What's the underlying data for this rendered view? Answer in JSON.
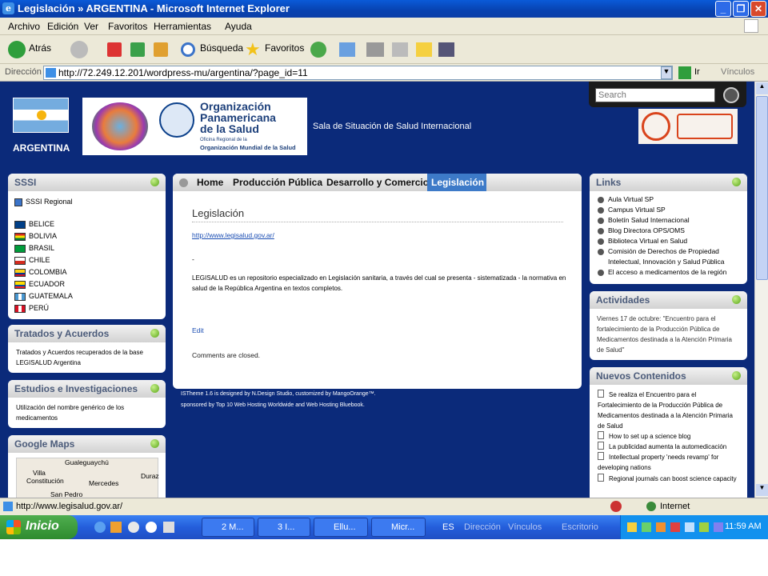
{
  "window": {
    "title": "Legislación » ARGENTINA - Microsoft Internet Explorer"
  },
  "menu": [
    "Archivo",
    "Edición",
    "Ver",
    "Favoritos",
    "Herramientas",
    "Ayuda"
  ],
  "toolbar": {
    "back": "Atrás",
    "search": "Búsqueda",
    "favorites": "Favoritos"
  },
  "address": {
    "label": "Dirección",
    "url": "http://72.249.12.201/wordpress-mu/argentina/?page_id=11",
    "go": "Ir",
    "links": "Vínculos"
  },
  "site": {
    "country": "ARGENTINA",
    "org_name_1": "Organización",
    "org_name_2": "Panamericana",
    "org_name_3": "de la Salud",
    "org_sub_1": "Oficina Regional de la",
    "org_sub_2": "Organización Mundial de la Salud",
    "tagline": "Sala de Situación de Salud Internacional",
    "search_placeholder": "Search"
  },
  "nav": [
    "Home",
    "Producción Pública",
    "Desarrollo y Comercio",
    "Legislación"
  ],
  "left": {
    "sssi": {
      "title": "SSSI",
      "regional": "SSSI Regional",
      "countries": [
        "BELICE",
        "BOLIVIA",
        "BRASIL",
        "CHILE",
        "COLOMBIA",
        "ECUADOR",
        "GUATEMALA",
        "PERÚ"
      ]
    },
    "tratados": {
      "title": "Tratados y Acuerdos",
      "text": "Tratados y Acuerdos recuperados de la base LEGISALUD Argentina"
    },
    "estudios": {
      "title": "Estudios e Investigaciones",
      "text": "Utilización del nombre genérico de los medicamentos"
    },
    "maps": {
      "title": "Google Maps",
      "labels": [
        "Gualeguaychú",
        "Villa",
        "Constitución",
        "Mercedes",
        "Duraz",
        "San Pedro"
      ]
    }
  },
  "main": {
    "title": "Legislación",
    "link": "http://www.legisalud.gov.ar/",
    "dash": "-",
    "body": "LEGISALUD es un repositorio especializado en  Legislación sanitaria,  a través del cual se presenta - sistematizada - la normativa en salud de la República Argentina en textos completos.",
    "edit": "Edit",
    "closed": "Comments are closed."
  },
  "footer": {
    "line1": "ISTheme 1.6 is designed by N.Design Studio, customized by MangoOrange™.",
    "line2": "sponsored by Top 10 Web Hosting Worldwide and Web Hosting Bluebook."
  },
  "right": {
    "links": {
      "title": "Links",
      "items": [
        "Aula Virtual SP",
        "Campus Virtual SP",
        "Boletín Salud Internacional",
        "Blog Directora OPS/OMS",
        "Biblioteca Virtual en Salud",
        "Comisión de Derechos de Propiedad",
        "Intelectual, Innovación y Salud Pública",
        "El acceso a medicamentos de la región"
      ]
    },
    "actividades": {
      "title": "Actividades",
      "text": "Viernes 17 de octubre: \"Encuentro para el fortalecimiento de la Producción Pública de Medicamentos destinada a la Atención Primaria de Salud\""
    },
    "nuevos": {
      "title": "Nuevos Contenidos",
      "items": [
        "Se realiza el Encuentro para el Fortalecimiento de la Producción Pública de Medicamentos destinada a la Atención Primaria de Salud",
        "How to set up a science blog",
        "La publicidad aumenta la automedicación",
        "Intellectual property 'needs revamp' for developing nations",
        "Regional journals can boost science capacity"
      ]
    }
  },
  "status": {
    "url": "http://www.legisalud.gov.ar/",
    "zone": "Internet"
  },
  "taskbar": {
    "start": "Inicio",
    "tasks": [
      "2 M...",
      "3 I...",
      "Ellu...",
      "Micr..."
    ],
    "lang": "ES",
    "tray_labels": [
      "Dirección",
      "Vínculos",
      "Escritorio"
    ],
    "clock": "11:59 AM"
  }
}
